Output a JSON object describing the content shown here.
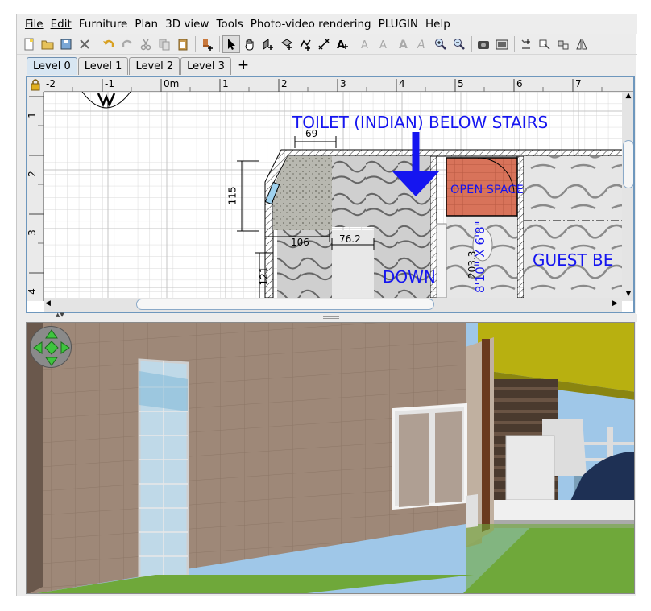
{
  "menu": {
    "items": [
      "File",
      "Edit",
      "Furniture",
      "Plan",
      "3D view",
      "Tools",
      "Photo-video rendering",
      "PLUGIN",
      "Help"
    ],
    "mnemonics": [
      "F",
      "E",
      "u",
      "P",
      "v",
      "T",
      "",
      "",
      "H"
    ]
  },
  "toolbar": {
    "icons": [
      "new-file-icon",
      "open-folder-icon",
      "save-icon",
      "cut-preferences-icon",
      "undo-icon",
      "redo-icon",
      "cut-icon",
      "copy-icon",
      "paste-icon",
      "add-furniture-icon",
      "select-arrow-icon",
      "pan-hand-icon",
      "create-walls-icon",
      "create-rooms-icon",
      "create-polylines-icon",
      "create-dimensions-icon",
      "add-text-icon",
      "text-style-icon",
      "bold-text-icon",
      "italic-text-icon",
      "increase-text-icon",
      "decrease-text-icon",
      "zoom-in-icon",
      "zoom-out-icon",
      "create-photo-icon",
      "create-video-icon",
      "import-furniture-icon",
      "import-texture-icon",
      "modify-icon",
      "flip-icon"
    ]
  },
  "levels": {
    "tabs": [
      "Level 0",
      "Level 1",
      "Level 2",
      "Level 3"
    ],
    "active_index": 0,
    "add_label": "+"
  },
  "plan": {
    "ruler_x_labels": [
      "-2",
      "-1",
      "0m",
      "1",
      "2",
      "3",
      "4",
      "5",
      "6",
      "7"
    ],
    "ruler_y_labels": [
      "1",
      "2",
      "3",
      "4"
    ],
    "title_label": "TOILET (INDIAN) BELOW STAIRS",
    "open_space_label": "OPEN SPACE",
    "down_label": "DOWN",
    "guest_label": "GUEST BE",
    "dimensions": [
      "69",
      "115",
      "106",
      "76.2",
      "203.3",
      "121",
      "8'10\" X 6'8\""
    ],
    "text_color": "#1515f0",
    "room_color": "#d8735a"
  },
  "view3d": {
    "navigator": "navigation-arrows-icon",
    "sky_color": "#9fc7e8",
    "wall_color": "#9e8878",
    "grass_color": "#6fa83a",
    "roof_color": "#b8b010"
  }
}
